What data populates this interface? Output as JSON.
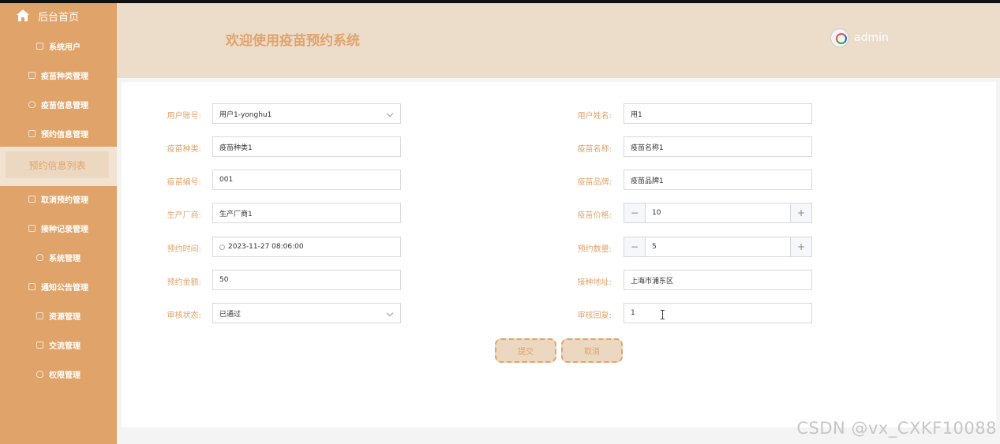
{
  "sidebar": {
    "home_label": "后台首页",
    "items": [
      {
        "label": "系统用户",
        "icon": "square-icon"
      },
      {
        "label": "疫苗种类管理",
        "icon": "square-icon"
      },
      {
        "label": "疫苗信息管理",
        "icon": "cloud-icon"
      },
      {
        "label": "预约信息管理",
        "icon": "edit-icon"
      },
      {
        "label": "预约信息列表",
        "icon": ""
      },
      {
        "label": "取消预约管理",
        "icon": "square-icon"
      },
      {
        "label": "接种记录管理",
        "icon": "edit-icon"
      },
      {
        "label": "系统管理",
        "icon": "cloud-icon"
      },
      {
        "label": "通知公告管理",
        "icon": "square-icon"
      },
      {
        "label": "资源管理",
        "icon": "square-icon"
      },
      {
        "label": "交流管理",
        "icon": "edit-icon"
      },
      {
        "label": "权限管理",
        "icon": "cloud-icon"
      }
    ]
  },
  "header": {
    "title": "欢迎使用疫苗预约系统",
    "username": "admin"
  },
  "form": {
    "user_account": {
      "label": "用户账号:",
      "value": "用户1-yonghu1"
    },
    "user_name": {
      "label": "用户姓名:",
      "value": "用1"
    },
    "vaccine_type": {
      "label": "疫苗种类:",
      "value": "疫苗种类1"
    },
    "vaccine_name": {
      "label": "疫苗名称:",
      "value": "疫苗名称1"
    },
    "vaccine_code": {
      "label": "疫苗编号:",
      "value": "001"
    },
    "vaccine_brand": {
      "label": "疫苗品牌:",
      "value": "疫苗品牌1"
    },
    "manufacturer": {
      "label": "生产厂商:",
      "value": "生产厂商1"
    },
    "vaccine_price": {
      "label": "疫苗价格:",
      "value": "10"
    },
    "appointment_time": {
      "label": "预约时间:",
      "value": "2023-11-27 08:06:00"
    },
    "appointment_qty": {
      "label": "预约数量:",
      "value": "5"
    },
    "appointment_amount": {
      "label": "预约金额:",
      "value": "50"
    },
    "vaccination_address": {
      "label": "接种地址:",
      "value": "上海市浦东区"
    },
    "review_status": {
      "label": "审核状态:",
      "value": "已通过"
    },
    "review_reply": {
      "label": "审核回复:",
      "value": "1"
    },
    "submit_label": "提交",
    "cancel_label": "取消"
  },
  "watermark": "CSDN @vx_CXKF10088",
  "colors": {
    "accent": "#e0a46a",
    "header_bg": "#ecdcca",
    "sidebar_bg": "#e0a46a"
  }
}
